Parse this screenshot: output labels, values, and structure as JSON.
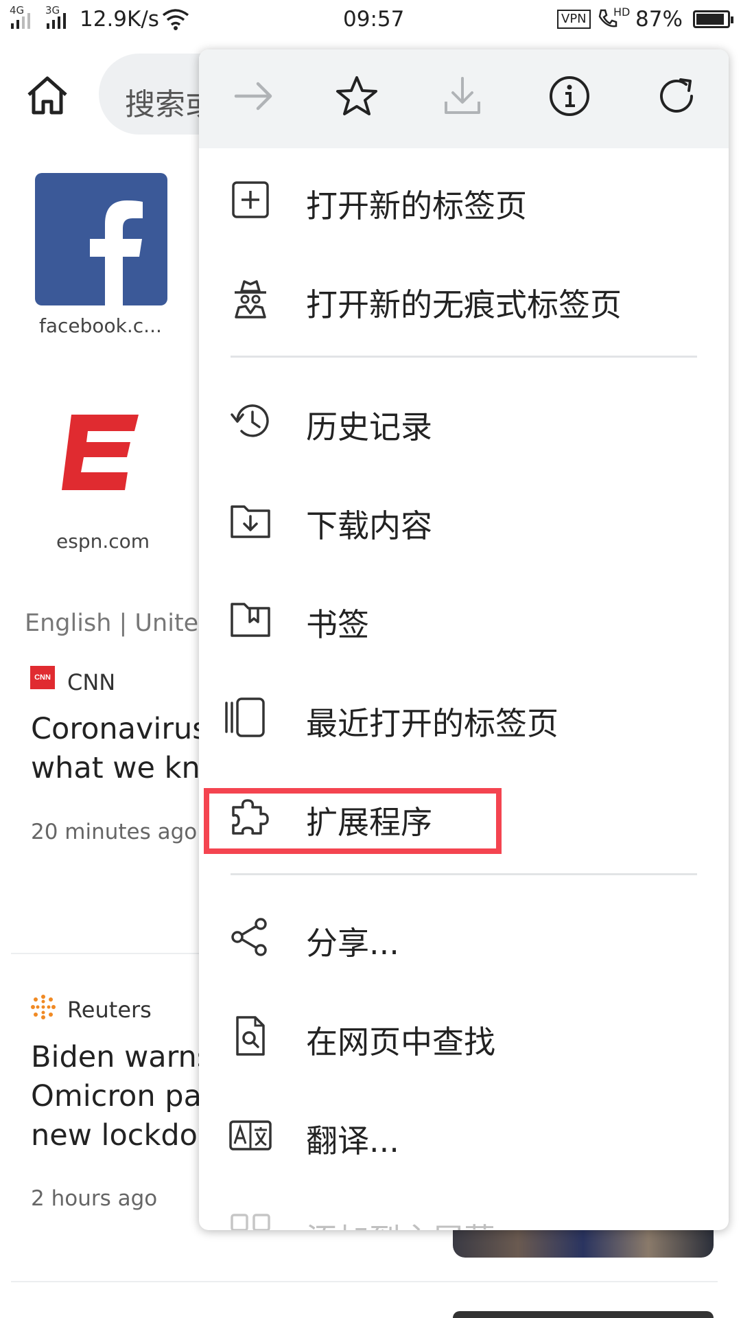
{
  "status_bar": {
    "network_1": "4G",
    "network_2": "3G",
    "speed": "12.9K/s",
    "time": "09:57",
    "vpn": "VPN",
    "hd": "HD",
    "battery": "87%",
    "battery_level": 0.87
  },
  "page": {
    "search_placeholder": "搜索或",
    "shortcuts": [
      {
        "label": "facebook.c..."
      },
      {
        "label": "espn.com"
      }
    ],
    "feed_language": "English | United",
    "articles": [
      {
        "source": "CNN",
        "source_logo": "CNN",
        "headline_lines": [
          "Coronavirus",
          "what we kno"
        ],
        "time": "20 minutes ago"
      },
      {
        "source": "Reuters",
        "headline_lines": [
          "Biden warns",
          "Omicron pa",
          "new lockdow"
        ],
        "time": "2 hours ago"
      }
    ]
  },
  "menu": {
    "toolbar": [
      {
        "icon": "forward-arrow-icon",
        "enabled": false
      },
      {
        "icon": "star-icon",
        "enabled": true
      },
      {
        "icon": "download-icon",
        "enabled": false
      },
      {
        "icon": "info-icon",
        "enabled": true
      },
      {
        "icon": "refresh-icon",
        "enabled": true
      }
    ],
    "items": [
      {
        "label": "打开新的标签页",
        "icon": "new-tab-icon"
      },
      {
        "label": "打开新的无痕式标签页",
        "icon": "incognito-icon"
      },
      {
        "label": "历史记录",
        "icon": "history-icon"
      },
      {
        "label": "下载内容",
        "icon": "downloads-icon"
      },
      {
        "label": "书签",
        "icon": "bookmarks-icon"
      },
      {
        "label": "最近打开的标签页",
        "icon": "recent-tabs-icon"
      },
      {
        "label": "扩展程序",
        "icon": "extensions-puzzle-icon"
      },
      {
        "label": "分享...",
        "icon": "share-icon"
      },
      {
        "label": "在网页中查找",
        "icon": "find-in-page-icon"
      },
      {
        "label": "翻译...",
        "icon": "translate-icon"
      },
      {
        "label": "添加到主屏幕",
        "icon": "add-to-home-icon"
      }
    ],
    "highlight_color": "#f44450"
  }
}
